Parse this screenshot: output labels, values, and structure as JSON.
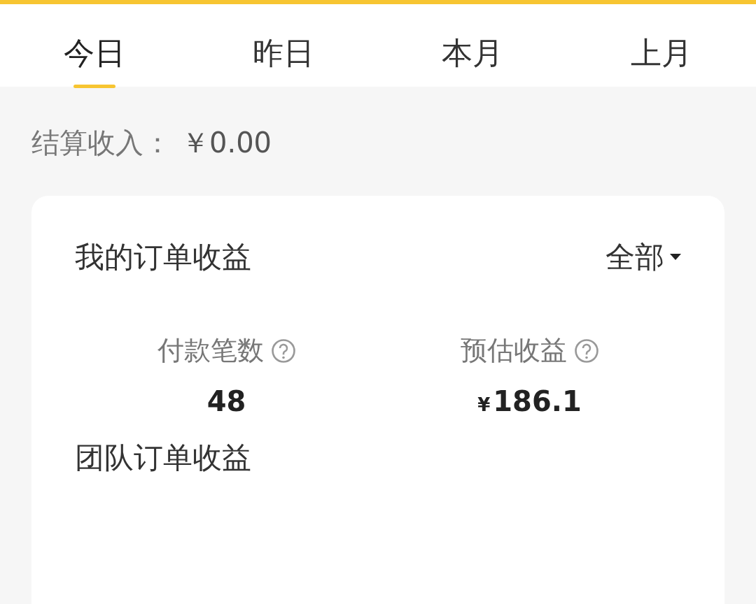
{
  "tabs": [
    {
      "label": "今日",
      "selected": true
    },
    {
      "label": "昨日",
      "selected": false
    },
    {
      "label": "本月",
      "selected": false
    },
    {
      "label": "上月",
      "selected": false
    }
  ],
  "settlement": {
    "label": "结算收入：",
    "value": "￥0.00"
  },
  "sections": [
    {
      "title": "我的订单收益",
      "filter": "全部",
      "stats": [
        {
          "label": "付款笔数",
          "value": "48"
        },
        {
          "label": "预估收益",
          "currency": "¥",
          "value": "186.1"
        }
      ]
    },
    {
      "title": "团队订单收益"
    }
  ]
}
